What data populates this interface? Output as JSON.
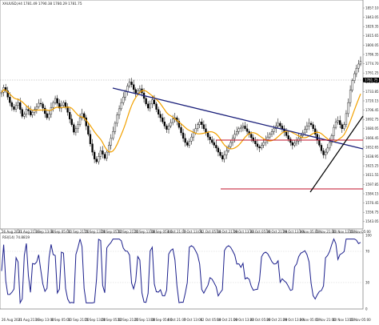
{
  "window": {
    "symbol_header": "XAUUSD,H4 1781.49 1790.38 1780.29 1781.75",
    "current_price_tag": "1781.75"
  },
  "price_axis": {
    "labels": [
      "1857.10",
      "1843.05",
      "1829.35",
      "1815.65",
      "1800.05",
      "1786.35",
      "1774.70",
      "1761.25",
      "1747.55",
      "1733.85",
      "1720.15",
      "1706.45",
      "1692.75",
      "1680.05",
      "1666.45",
      "1652.65",
      "1638.95",
      "1625.25",
      "1611.55",
      "1597.85",
      "1584.15",
      "1570.45",
      "1556.75",
      "1543.05"
    ]
  },
  "time_axis": {
    "labels": [
      "26 Aug 2021",
      "31 Aug 21:00",
      "3 Sep 13:00",
      "8 Sep 05:00",
      "10 Sep 21:00",
      "15 Sep 13:00",
      "20 Sep 05:00",
      "22 Sep 21:00",
      "27 Sep 13:00",
      "30 Sep 05:00",
      "4 Oct 21:00",
      "7 Oct 13:00",
      "12 Oct 05:00",
      "14 Oct 21:00",
      "19 Oct 13:00",
      "22 Oct 05:00",
      "26 Oct 21:00",
      "29 Oct 13:00",
      "3 Nov 05:00",
      "5 Nov 21:00",
      "10 Nov 13:00",
      "15 Nov 05:00"
    ]
  },
  "indicator": {
    "header": "RSI(14) 74.8819",
    "scale_labels": [
      "100",
      "70",
      "30",
      "0"
    ]
  },
  "colors": {
    "candles": "#000000",
    "moving_average": "#f2a100",
    "downtrend_line": "#1a1f7a",
    "range_lines": "#c0102a",
    "uptrend_line": "#000000",
    "rsi_line": "#1b1f8c"
  },
  "chart_data": {
    "type": "candlestick",
    "title": "XAUUSD,H4 1781.49 1790.38 1780.29 1781.75",
    "close_path": [
      1737,
      1744,
      1739,
      1730,
      1722,
      1716,
      1712,
      1718,
      1722,
      1712,
      1702,
      1705,
      1712,
      1710,
      1704,
      1708,
      1712,
      1716,
      1721,
      1720,
      1714,
      1706,
      1700,
      1705,
      1715,
      1722,
      1728,
      1721,
      1714,
      1718,
      1722,
      1716,
      1708,
      1698,
      1690,
      1679,
      1684,
      1690,
      1700,
      1706,
      1700,
      1688,
      1676,
      1662,
      1650,
      1640,
      1636,
      1644,
      1652,
      1647,
      1641,
      1650,
      1660,
      1670,
      1680,
      1692,
      1704,
      1713,
      1722,
      1730,
      1738,
      1746,
      1752,
      1748,
      1741,
      1736,
      1739,
      1742,
      1736,
      1728,
      1720,
      1714,
      1720,
      1726,
      1720,
      1712,
      1705,
      1700,
      1694,
      1688,
      1683,
      1688,
      1693,
      1698,
      1700,
      1695,
      1686,
      1678,
      1670,
      1664,
      1660,
      1666,
      1672,
      1678,
      1684,
      1690,
      1694,
      1690,
      1684,
      1678,
      1672,
      1668,
      1664,
      1660,
      1656,
      1650,
      1645,
      1640,
      1646,
      1652,
      1658,
      1664,
      1670,
      1676,
      1680,
      1684,
      1686,
      1688,
      1684,
      1680,
      1676,
      1671,
      1666,
      1662,
      1658,
      1656,
      1660,
      1664,
      1668,
      1672,
      1676,
      1680,
      1684,
      1688,
      1692,
      1688,
      1684,
      1679,
      1674,
      1669,
      1664,
      1660,
      1663,
      1666,
      1670,
      1674,
      1678,
      1683,
      1688,
      1692,
      1690,
      1684,
      1676,
      1668,
      1660,
      1652,
      1646,
      1650,
      1656,
      1664,
      1674,
      1686,
      1694,
      1696,
      1690,
      1684,
      1690,
      1706,
      1722,
      1740,
      1754,
      1764,
      1772,
      1778,
      1782
    ],
    "price_range": [
      1543.05,
      1857.1
    ],
    "moving_average": "orange trend-following average",
    "annotations": [
      "descending blue trendline from early September to 5 Nov",
      "red range lines at about 1684 and 1620",
      "black ascending trendline from 3 Nov low"
    ],
    "rsi": {
      "name": "RSI(14)",
      "current": 74.8819,
      "levels": [
        30,
        70
      ],
      "range": [
        0,
        100
      ]
    }
  }
}
